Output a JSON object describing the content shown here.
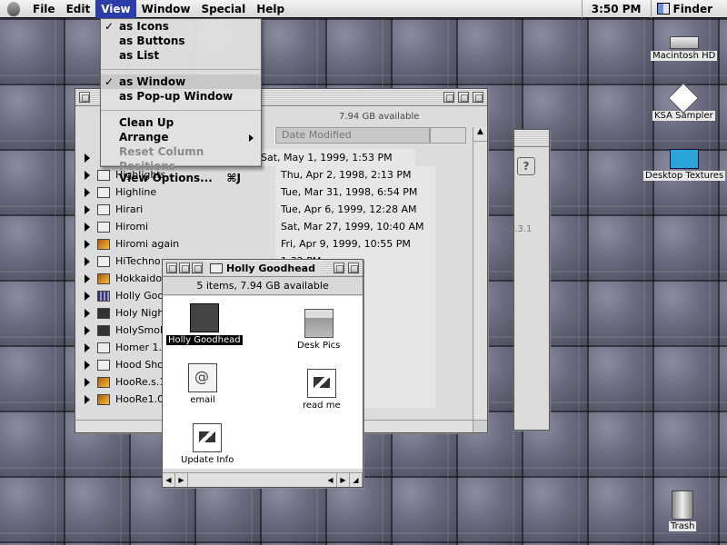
{
  "menubar": {
    "items": [
      "File",
      "Edit",
      "View",
      "Window",
      "Special",
      "Help"
    ],
    "clock": "3:50 PM",
    "app_name": "Finder"
  },
  "view_menu": {
    "items": [
      {
        "label": "as Icons",
        "checked": true
      },
      {
        "label": "as Buttons"
      },
      {
        "label": "as List"
      },
      {
        "label": "as Window",
        "checked": true
      },
      {
        "label": "as Pop-up Window"
      },
      {
        "label": "Clean Up"
      },
      {
        "label": "Arrange",
        "submenu": true
      },
      {
        "label": "Reset Column Positions",
        "disabled": true
      },
      {
        "label": "View Options...",
        "shortcut": "⌘J"
      }
    ],
    "check_mark": "✓"
  },
  "list_window": {
    "status": "7.94 GB available",
    "col_date": "Date Modified",
    "rows": [
      {
        "name": "",
        "date": "Sat, May 1, 1999, 1:53 PM"
      },
      {
        "name": "Highlights",
        "date": "Thu, Apr 2, 1998, 2:13 PM"
      },
      {
        "name": "Highline",
        "date": "Tue, Mar 31, 1998, 6:54 PM"
      },
      {
        "name": "Hirari",
        "date": "Tue, Apr 6, 1999, 12:28 AM"
      },
      {
        "name": "Hiromi",
        "date": "Sat, Mar 27, 1999, 10:40 AM"
      },
      {
        "name": "Hiromi again",
        "date": "Fri, Apr 9, 1999, 10:55 PM"
      },
      {
        "name": "HiTechno",
        "date": "1:32 PM"
      },
      {
        "name": "Hokkaido",
        "date": "12:55 PM"
      },
      {
        "name": "Holly Good",
        "date": "10:22 PM"
      },
      {
        "name": "Holy Night",
        "date": "4:51 AM"
      },
      {
        "name": "HolySmok",
        "date": "7:22 AM"
      },
      {
        "name": "Homer 1.0",
        "date": "12:35 PM"
      },
      {
        "name": "Hood Shoc",
        "date": "9, 7:47 PM"
      },
      {
        "name": "HooRe.s.1",
        "date": "10:50 PM"
      },
      {
        "name": "HooRe1.0",
        "date": "10:55 PM"
      }
    ]
  },
  "back_window": {
    "version": "v2.3.1"
  },
  "icon_window": {
    "title": "Holly Goodhead",
    "status": "5 items, 7.94 GB available",
    "items": [
      {
        "label": "Holly Goodhead",
        "icon": "folder-dark-icon"
      },
      {
        "label": "Desk Pics",
        "icon": "desk-pics-icon"
      },
      {
        "label": "email",
        "icon": "email-doc-icon"
      },
      {
        "label": "read me",
        "icon": "readme-doc-icon"
      },
      {
        "label": "Update Info",
        "icon": "update-doc-icon"
      }
    ]
  },
  "desktop": {
    "icons": [
      {
        "label": "Macintosh HD",
        "icon": "hard-disk-icon"
      },
      {
        "label": "KSA Sampler",
        "icon": "cd-icon"
      },
      {
        "label": "Desktop Textures",
        "icon": "folder-textures-icon"
      },
      {
        "label": "Trash",
        "icon": "trash-icon"
      }
    ]
  }
}
